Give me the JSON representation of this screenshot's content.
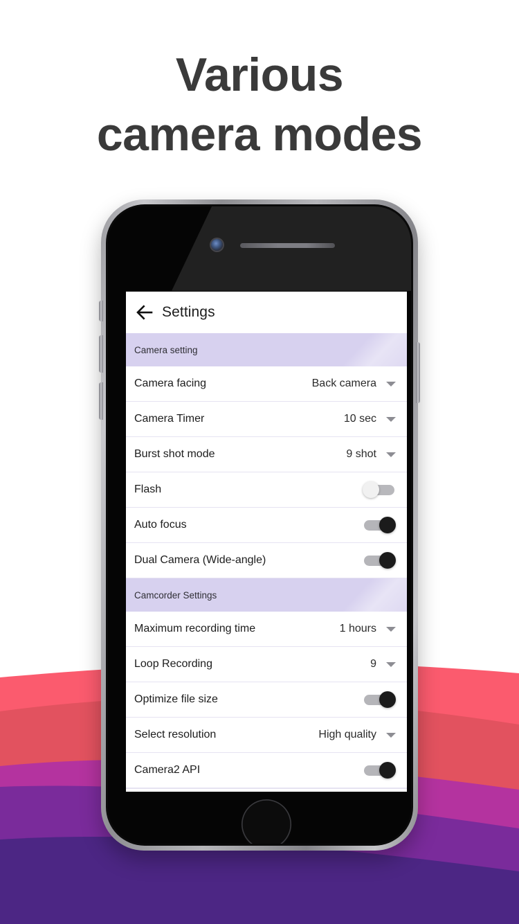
{
  "headline": {
    "line1": "Various",
    "line2": "camera modes"
  },
  "colors": {
    "headline_text": "#3a3a3a",
    "section_header_bg": "#d7d1ef",
    "row_divider": "#e6e3f2",
    "toggle_on_thumb": "#1b1b1b",
    "toggle_off_thumb": "#f1f1f1",
    "wave_coral": "#fb5b6e",
    "wave_red": "#e2525f",
    "wave_magenta": "#b4339f",
    "wave_purple": "#7a2b9b",
    "wave_indigo": "#4c2684",
    "phone_bezel": "#b6b6ba",
    "screen_bg": "#ffffff"
  },
  "app": {
    "appbar": {
      "back_icon": "arrow-left-icon",
      "title": "Settings"
    },
    "sections": [
      {
        "header": "Camera setting",
        "rows": [
          {
            "label": "Camera facing",
            "type": "select",
            "value": "Back camera"
          },
          {
            "label": "Camera Timer",
            "type": "select",
            "value": "10 sec"
          },
          {
            "label": "Burst shot mode",
            "type": "select",
            "value": "9 shot"
          },
          {
            "label": "Flash",
            "type": "toggle",
            "state": "off"
          },
          {
            "label": "Auto focus",
            "type": "toggle",
            "state": "on"
          },
          {
            "label": "Dual Camera (Wide-angle)",
            "type": "toggle",
            "state": "on"
          }
        ]
      },
      {
        "header": "Camcorder Settings",
        "rows": [
          {
            "label": "Maximum recording time",
            "type": "select",
            "value": "1 hours"
          },
          {
            "label": "Loop Recording",
            "type": "select",
            "value": "9"
          },
          {
            "label": "Optimize file size",
            "type": "toggle",
            "state": "on"
          },
          {
            "label": "Select resolution",
            "type": "select",
            "value": "High quality"
          },
          {
            "label": "Camera2 API",
            "type": "toggle",
            "state": "on"
          }
        ]
      }
    ]
  },
  "device": {
    "front_camera": "front-camera-lens",
    "earpiece": "earpiece-speaker",
    "home_button": "home-button",
    "volume_up": "volume-up-button",
    "volume_down": "volume-down-button",
    "mute_switch": "mute-switch",
    "power": "power-button"
  }
}
